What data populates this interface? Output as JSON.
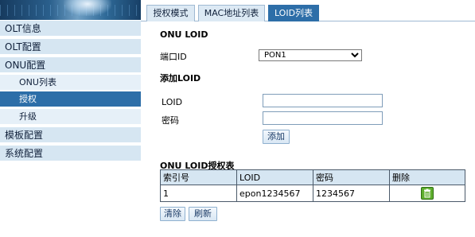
{
  "sidebar": {
    "items": [
      {
        "label": "OLT信息"
      },
      {
        "label": "OLT配置"
      },
      {
        "label": "ONU配置"
      },
      {
        "label": "ONU列表"
      },
      {
        "label": "授权"
      },
      {
        "label": "升级"
      },
      {
        "label": "模板配置"
      },
      {
        "label": "系统配置"
      }
    ]
  },
  "tabs": [
    {
      "label": "授权模式"
    },
    {
      "label": "MAC地址列表"
    },
    {
      "label": "LOID列表"
    }
  ],
  "onu_loid": {
    "title": "ONU LOID",
    "port_label": "端口ID",
    "port_value": "PON1"
  },
  "add_loid": {
    "title": "添加LOID",
    "loid_label": "LOID",
    "password_label": "密码",
    "loid_value": "",
    "password_value": "",
    "add_button": "添加"
  },
  "auth_table": {
    "title": "ONU LOID授权表",
    "headers": [
      "索引号",
      "LOID",
      "密码",
      "删除"
    ],
    "rows": [
      {
        "index": "1",
        "loid": "epon1234567",
        "password": "1234567",
        "delete_icon": "trash-icon"
      }
    ],
    "clear_button": "清除",
    "refresh_button": "刷新"
  },
  "colors": {
    "active_blue": "#2d6ea8",
    "nav_bg": "#d6e6f2",
    "table_header_bg": "#d6e6f2",
    "delete_icon_green": "#5fae2e"
  }
}
